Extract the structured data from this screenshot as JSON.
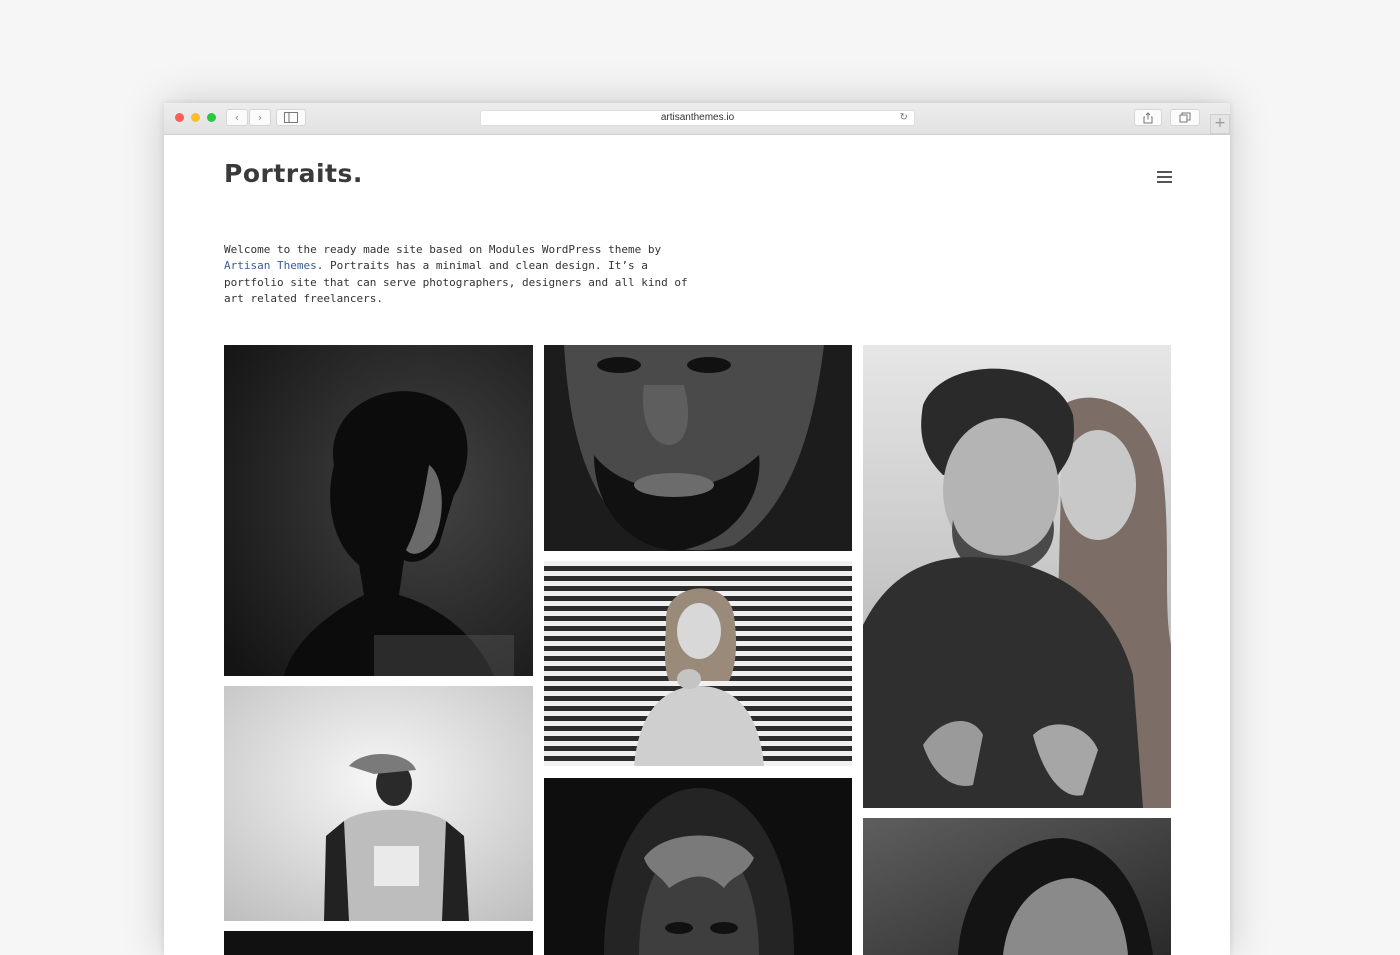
{
  "browser": {
    "url": "artisanthemes.io",
    "back_icon": "chevron-left-icon",
    "forward_icon": "chevron-right-icon",
    "sidebar_icon": "sidebar-icon",
    "reload_icon": "reload-icon",
    "share_icon": "share-icon",
    "tabs_icon": "tabs-icon",
    "new_tab_icon": "plus-icon"
  },
  "site": {
    "logo": "Portraits.",
    "menu_icon": "hamburger-icon",
    "intro_before": "Welcome to the ready made site based on Modules WordPress theme by ",
    "intro_link": "Artisan Themes",
    "intro_after": ". Portraits has a minimal and clean design. It’s a portfolio site that can serve photographers, designers and all kind of art related freelancers."
  },
  "colors": {
    "link": "#3c5b9a",
    "text": "#333333",
    "logo": "#3a3a3a"
  },
  "gallery": {
    "photos": [
      {
        "name": "photo-curly-hair-profile"
      },
      {
        "name": "photo-bearded-man-closeup"
      },
      {
        "name": "photo-couple-embrace"
      },
      {
        "name": "photo-man-in-cap"
      },
      {
        "name": "photo-woman-striped-background"
      },
      {
        "name": "photo-hooded-man"
      },
      {
        "name": "photo-woman-hair"
      },
      {
        "name": "photo-dark-bottom"
      }
    ]
  }
}
